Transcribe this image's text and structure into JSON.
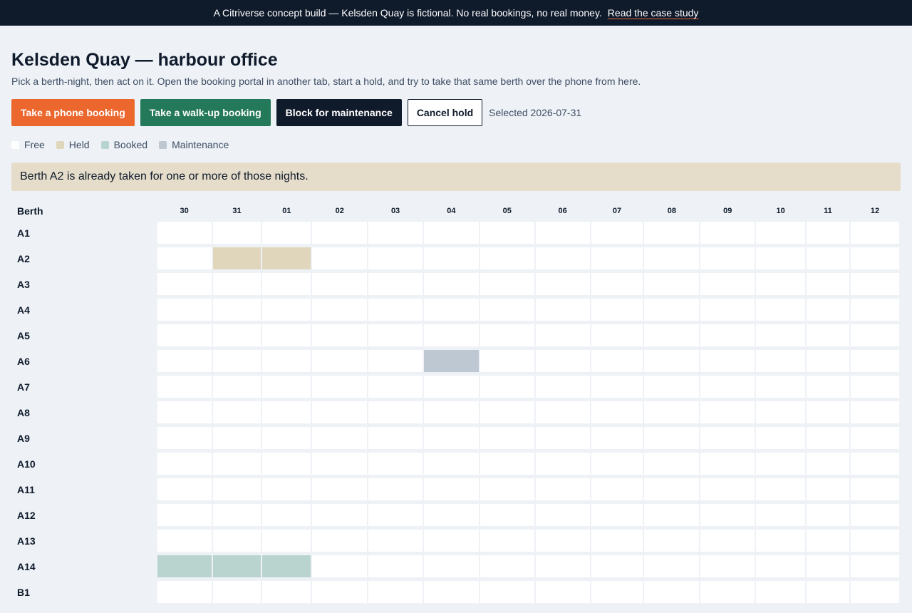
{
  "banner": {
    "text": "A Citriverse concept build — Kelsden Quay is fictional. No real bookings, no real money.",
    "link": "Read the case study"
  },
  "page": {
    "title": "Kelsden Quay — harbour office",
    "subtitle": "Pick a berth-night, then act on it. Open the booking portal in another tab, start a hold, and try to take that same berth over the phone from here."
  },
  "toolbar": {
    "phone_booking": "Take a phone booking",
    "walkup_booking": "Take a walk-up booking",
    "block_maintenance": "Block for maintenance",
    "cancel_hold": "Cancel hold",
    "selected": "Selected 2026-07-31"
  },
  "legend": [
    {
      "label": "Free",
      "color": "#ffffff"
    },
    {
      "label": "Held",
      "color": "#e0d6bb"
    },
    {
      "label": "Booked",
      "color": "#b9d4cf"
    },
    {
      "label": "Maintenance",
      "color": "#bec8d2"
    }
  ],
  "alert": "Berth A2 is already taken for one or more of those nights.",
  "grid": {
    "berth_header": "Berth",
    "dates": [
      "30",
      "31",
      "01",
      "02",
      "03",
      "04",
      "05",
      "06",
      "07",
      "08",
      "09",
      "10",
      "11",
      "12"
    ],
    "rows": [
      {
        "berth": "A1",
        "states": [
          "free",
          "free",
          "free",
          "free",
          "free",
          "free",
          "free",
          "free",
          "free",
          "free",
          "free",
          "free",
          "free",
          "free"
        ]
      },
      {
        "berth": "A2",
        "states": [
          "free",
          "held",
          "held",
          "free",
          "free",
          "free",
          "free",
          "free",
          "free",
          "free",
          "free",
          "free",
          "free",
          "free"
        ]
      },
      {
        "berth": "A3",
        "states": [
          "free",
          "free",
          "free",
          "free",
          "free",
          "free",
          "free",
          "free",
          "free",
          "free",
          "free",
          "free",
          "free",
          "free"
        ]
      },
      {
        "berth": "A4",
        "states": [
          "free",
          "free",
          "free",
          "free",
          "free",
          "free",
          "free",
          "free",
          "free",
          "free",
          "free",
          "free",
          "free",
          "free"
        ]
      },
      {
        "berth": "A5",
        "states": [
          "free",
          "free",
          "free",
          "free",
          "free",
          "free",
          "free",
          "free",
          "free",
          "free",
          "free",
          "free",
          "free",
          "free"
        ]
      },
      {
        "berth": "A6",
        "states": [
          "free",
          "free",
          "free",
          "free",
          "free",
          "maintenance",
          "free",
          "free",
          "free",
          "free",
          "free",
          "free",
          "free",
          "free"
        ]
      },
      {
        "berth": "A7",
        "states": [
          "free",
          "free",
          "free",
          "free",
          "free",
          "free",
          "free",
          "free",
          "free",
          "free",
          "free",
          "free",
          "free",
          "free"
        ]
      },
      {
        "berth": "A8",
        "states": [
          "free",
          "free",
          "free",
          "free",
          "free",
          "free",
          "free",
          "free",
          "free",
          "free",
          "free",
          "free",
          "free",
          "free"
        ]
      },
      {
        "berth": "A9",
        "states": [
          "free",
          "free",
          "free",
          "free",
          "free",
          "free",
          "free",
          "free",
          "free",
          "free",
          "free",
          "free",
          "free",
          "free"
        ]
      },
      {
        "berth": "A10",
        "states": [
          "free",
          "free",
          "free",
          "free",
          "free",
          "free",
          "free",
          "free",
          "free",
          "free",
          "free",
          "free",
          "free",
          "free"
        ]
      },
      {
        "berth": "A11",
        "states": [
          "free",
          "free",
          "free",
          "free",
          "free",
          "free",
          "free",
          "free",
          "free",
          "free",
          "free",
          "free",
          "free",
          "free"
        ]
      },
      {
        "berth": "A12",
        "states": [
          "free",
          "free",
          "free",
          "free",
          "free",
          "free",
          "free",
          "free",
          "free",
          "free",
          "free",
          "free",
          "free",
          "free"
        ]
      },
      {
        "berth": "A13",
        "states": [
          "free",
          "free",
          "free",
          "free",
          "free",
          "free",
          "free",
          "free",
          "free",
          "free",
          "free",
          "free",
          "free",
          "free"
        ]
      },
      {
        "berth": "A14",
        "states": [
          "booked",
          "booked",
          "booked",
          "free",
          "free",
          "free",
          "free",
          "free",
          "free",
          "free",
          "free",
          "free",
          "free",
          "free"
        ]
      },
      {
        "berth": "B1",
        "states": [
          "free",
          "free",
          "free",
          "free",
          "free",
          "free",
          "free",
          "free",
          "free",
          "free",
          "free",
          "free",
          "free",
          "free"
        ]
      }
    ]
  }
}
